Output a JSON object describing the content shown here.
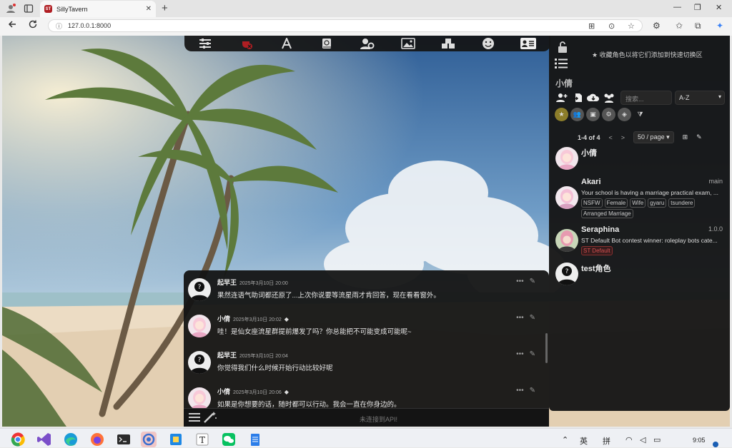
{
  "browser": {
    "tab_title": "SillyTavern",
    "favicon_text": "ST",
    "tab_close": "✕",
    "new_tab": "+",
    "address": "127.0.0.1:8000",
    "window_controls": {
      "minimize": "—",
      "restore": "❐",
      "close": "✕"
    }
  },
  "toolbar_icons": [
    "sliders-icon",
    "plug-icon",
    "font-icon",
    "book-icon",
    "user-gear-icon",
    "image-icon",
    "cubes-icon",
    "smile-icon",
    "character-card-icon"
  ],
  "right_panel": {
    "favorites_hint": "★ 收藏角色以将它们添加到快速切换区",
    "current_character": "小倩",
    "search_placeholder": "搜索...",
    "sort_value": "A-Z",
    "sort_caret": "▾",
    "pager": {
      "count": "1-4 of 4",
      "prev": "<",
      "next": ">",
      "per_page": "50 / page ▾"
    },
    "characters": [
      {
        "name": "小倩",
        "version": "",
        "description": "",
        "tags": []
      },
      {
        "name": "Akari",
        "version": "main",
        "description": "Your school is having a marriage practical exam, ...",
        "tags": [
          "NSFW",
          "Female",
          "Wife",
          "gyaru",
          "tsundere",
          "Arranged Marriage"
        ]
      },
      {
        "name": "Seraphina",
        "version": "1.0.0",
        "description": "ST Default Bot contest winner: roleplay bots cate...",
        "tags": [
          "ST Default"
        ]
      },
      {
        "name": "test角色",
        "version": "",
        "description": "",
        "tags": []
      }
    ]
  },
  "chat": {
    "messages": [
      {
        "sender": "起早王",
        "time": "2025年3月10日 20:00",
        "is_bot": false,
        "text": "果然连语气助词都还原了...上次你说要等流星雨才肯回答，现在看看窗外。"
      },
      {
        "sender": "小倩",
        "time": "2025年3月10日 20:02",
        "is_bot": true,
        "text": "哇！是仙女座流星群提前爆发了吗？你总能把不可能变成可能呢~"
      },
      {
        "sender": "起早王",
        "time": "2025年3月10日 20:04",
        "is_bot": false,
        "text": "你觉得我们什么时候开始行动比较好呢"
      },
      {
        "sender": "小倩",
        "time": "2025年3月10日 20:06",
        "is_bot": true,
        "text": "如果是你想要的话，随时都可以行动。我会一直在你身边的。"
      }
    ],
    "actions": {
      "more": "•••",
      "edit": "✎"
    },
    "bot_badge": "◆",
    "input_hint": "未连接到API!"
  },
  "taskbar": {
    "ime": "英",
    "ime2": "拼",
    "time": "9:05"
  },
  "colors": {
    "accent_red": "#b01e23",
    "panel_bg": "#161616",
    "fav_active": "#8c7d2a"
  }
}
